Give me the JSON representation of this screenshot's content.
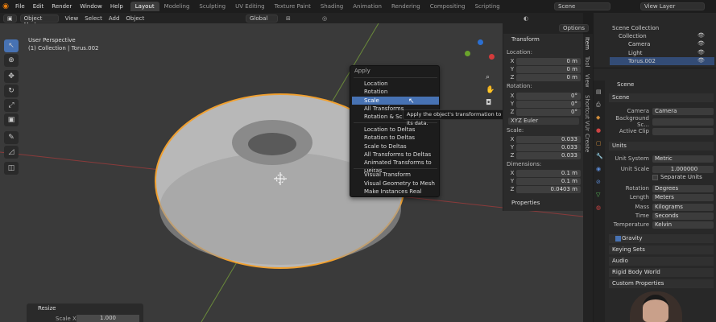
{
  "menubar": {
    "items": [
      "File",
      "Edit",
      "Render",
      "Window",
      "Help"
    ]
  },
  "workspaces": [
    "Layout",
    "Modeling",
    "Sculpting",
    "UV Editing",
    "Texture Paint",
    "Shading",
    "Animation",
    "Rendering",
    "Compositing",
    "Scripting"
  ],
  "active_workspace": "Layout",
  "scene_field": "Scene",
  "view_layer_field": "View Layer",
  "header": {
    "mode": "Object Mode",
    "menus": [
      "View",
      "Select",
      "Add",
      "Object"
    ],
    "transform": "Global",
    "options": "Options"
  },
  "viewport": {
    "view_name": "User Perspective",
    "collection_info": "(1) Collection | Torus.002"
  },
  "apply_menu": {
    "title": "Apply",
    "group1": [
      "Location",
      "Rotation",
      "Scale",
      "All Transforms",
      "Rotation & Scale"
    ],
    "group2": [
      "Location to Deltas",
      "Rotation to Deltas",
      "Scale to Deltas",
      "All Transforms to Deltas",
      "Animated Transforms to Deltas"
    ],
    "group3": [
      "Visual Transform",
      "Visual Geometry to Mesh",
      "Make Instances Real"
    ],
    "highlighted": "Scale"
  },
  "tooltip": "Apply the object's transformation to its data.",
  "npanel": {
    "title": "Transform",
    "location_label": "Location:",
    "location": [
      {
        "axis": "X",
        "value": "0 m"
      },
      {
        "axis": "Y",
        "value": "0 m"
      },
      {
        "axis": "Z",
        "value": "0 m"
      }
    ],
    "rotation_label": "Rotation:",
    "rotation": [
      {
        "axis": "X",
        "value": "0°"
      },
      {
        "axis": "Y",
        "value": "0°"
      },
      {
        "axis": "Z",
        "value": "0°"
      }
    ],
    "rotation_mode": "XYZ Euler",
    "scale_label": "Scale:",
    "scale": [
      {
        "axis": "X",
        "value": "0.033"
      },
      {
        "axis": "Y",
        "value": "0.033"
      },
      {
        "axis": "Z",
        "value": "0.033"
      }
    ],
    "dimensions_label": "Dimensions:",
    "dimensions": [
      {
        "axis": "X",
        "value": "0.1 m"
      },
      {
        "axis": "Y",
        "value": "0.1 m"
      },
      {
        "axis": "Z",
        "value": "0.0403 m"
      }
    ],
    "properties": "Properties"
  },
  "side_tabs": [
    "Item",
    "Tool",
    "View",
    "Shortcut VUr",
    "Create"
  ],
  "outliner": {
    "root": "Scene Collection",
    "collection": "Collection",
    "items": [
      "Camera",
      "Light",
      "Torus.002"
    ]
  },
  "properties": {
    "breadcrumb": "Scene",
    "scene_section": "Scene",
    "camera_label": "Camera",
    "camera_value": "Camera",
    "bg_label": "Background Sc...",
    "clip_label": "Active Clip",
    "units_section": "Units",
    "unit_system_label": "Unit System",
    "unit_system": "Metric",
    "unit_scale_label": "Unit Scale",
    "unit_scale": "1.000000",
    "separate_units": "Separate Units",
    "rotation_label": "Rotation",
    "rotation": "Degrees",
    "length_label": "Length",
    "length": "Meters",
    "mass_label": "Mass",
    "mass": "Kilograms",
    "time_label": "Time",
    "time": "Seconds",
    "temperature_label": "Temperature",
    "temperature": "Kelvin",
    "sections": [
      "Gravity",
      "Keying Sets",
      "Audio",
      "Rigid Body World",
      "Custom Properties"
    ]
  },
  "resize_panel": {
    "title": "Resize",
    "scale_x_label": "Scale X",
    "scale_x": "1.000"
  }
}
